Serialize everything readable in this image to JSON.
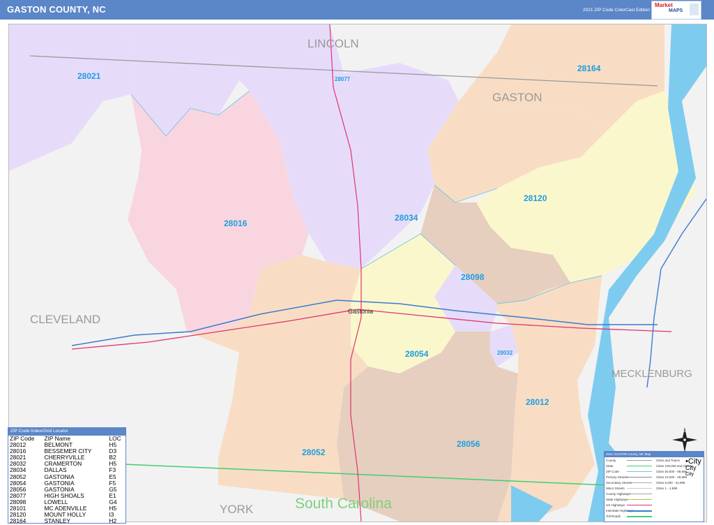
{
  "header": {
    "title": "GASTON COUNTY, NC",
    "edition": "2021 ZIP Code ColorCast Edition",
    "logo_market": "Market",
    "logo_maps": "MAPS"
  },
  "map": {
    "counties": {
      "lincoln": "LINCOLN",
      "gaston": "GASTON",
      "cleveland": "CLEVELAND",
      "mecklenburg": "MECKLENBURG",
      "york": "YORK"
    },
    "state": "South Carolina",
    "zips": {
      "z28021": "28021",
      "z28077": "28077",
      "z28164": "28164",
      "z28016": "28016",
      "z28034": "28034",
      "z28120": "28120",
      "z28098": "28098",
      "z28054": "28054",
      "z28032": "28032",
      "z28012": "28012",
      "z28056": "28056",
      "z28052": "28052"
    },
    "cities": {
      "gastonia": "Gastonia"
    },
    "colors": {
      "purple": "#e6dcfa",
      "pink": "#f9d6df",
      "orange": "#f8ddc4",
      "yellow": "#fbf7cd",
      "brown": "#e6cfbf",
      "zip_label": "#1e9ee0",
      "header": "#5b86c8"
    }
  },
  "index": {
    "title": "ZIP Code Index/Grid Locator",
    "columns": [
      "ZIP Code",
      "ZIP Name",
      "LOC"
    ],
    "rows": [
      [
        "28012",
        "BELMONT",
        "H5"
      ],
      [
        "28016",
        "BESSEMER CITY",
        "D3"
      ],
      [
        "28021",
        "CHERRYVILLE",
        "B2"
      ],
      [
        "28032",
        "CRAMERTON",
        "H5"
      ],
      [
        "28034",
        "DALLAS",
        "F3"
      ],
      [
        "28052",
        "GASTONIA",
        "E5"
      ],
      [
        "28054",
        "GASTONIA",
        "F5"
      ],
      [
        "28056",
        "GASTONIA",
        "G5"
      ],
      [
        "28077",
        "HIGH SHOALS",
        "E1"
      ],
      [
        "28098",
        "LOWELL",
        "G4"
      ],
      [
        "28101",
        "MC ADENVILLE",
        "H5"
      ],
      [
        "28120",
        "MOUNT HOLLY",
        "I3"
      ],
      [
        "28164",
        "STANLEY",
        "H2"
      ]
    ]
  },
  "legend": {
    "title": "2021 GASTON County, NC Map",
    "left": [
      "County",
      "State",
      "ZIP Code",
      "Primary Streets",
      "Secondary Streets",
      "Minor Streets",
      "County Highways",
      "State Highways",
      "US Highways",
      "Interstate Highways",
      "Toll Roads"
    ],
    "right": [
      "Cities and Towns",
      "Cities 100,000 and Above",
      "Cities 50,000 - 99,999",
      "Cities 10,000 - 49,999",
      "Cities 5,000 - 24,999",
      "Cities 1 - 4,999"
    ],
    "city_samples": [
      "City",
      "City",
      "City"
    ],
    "city_sample_prefix": "•"
  },
  "compass": {
    "north": "N"
  }
}
